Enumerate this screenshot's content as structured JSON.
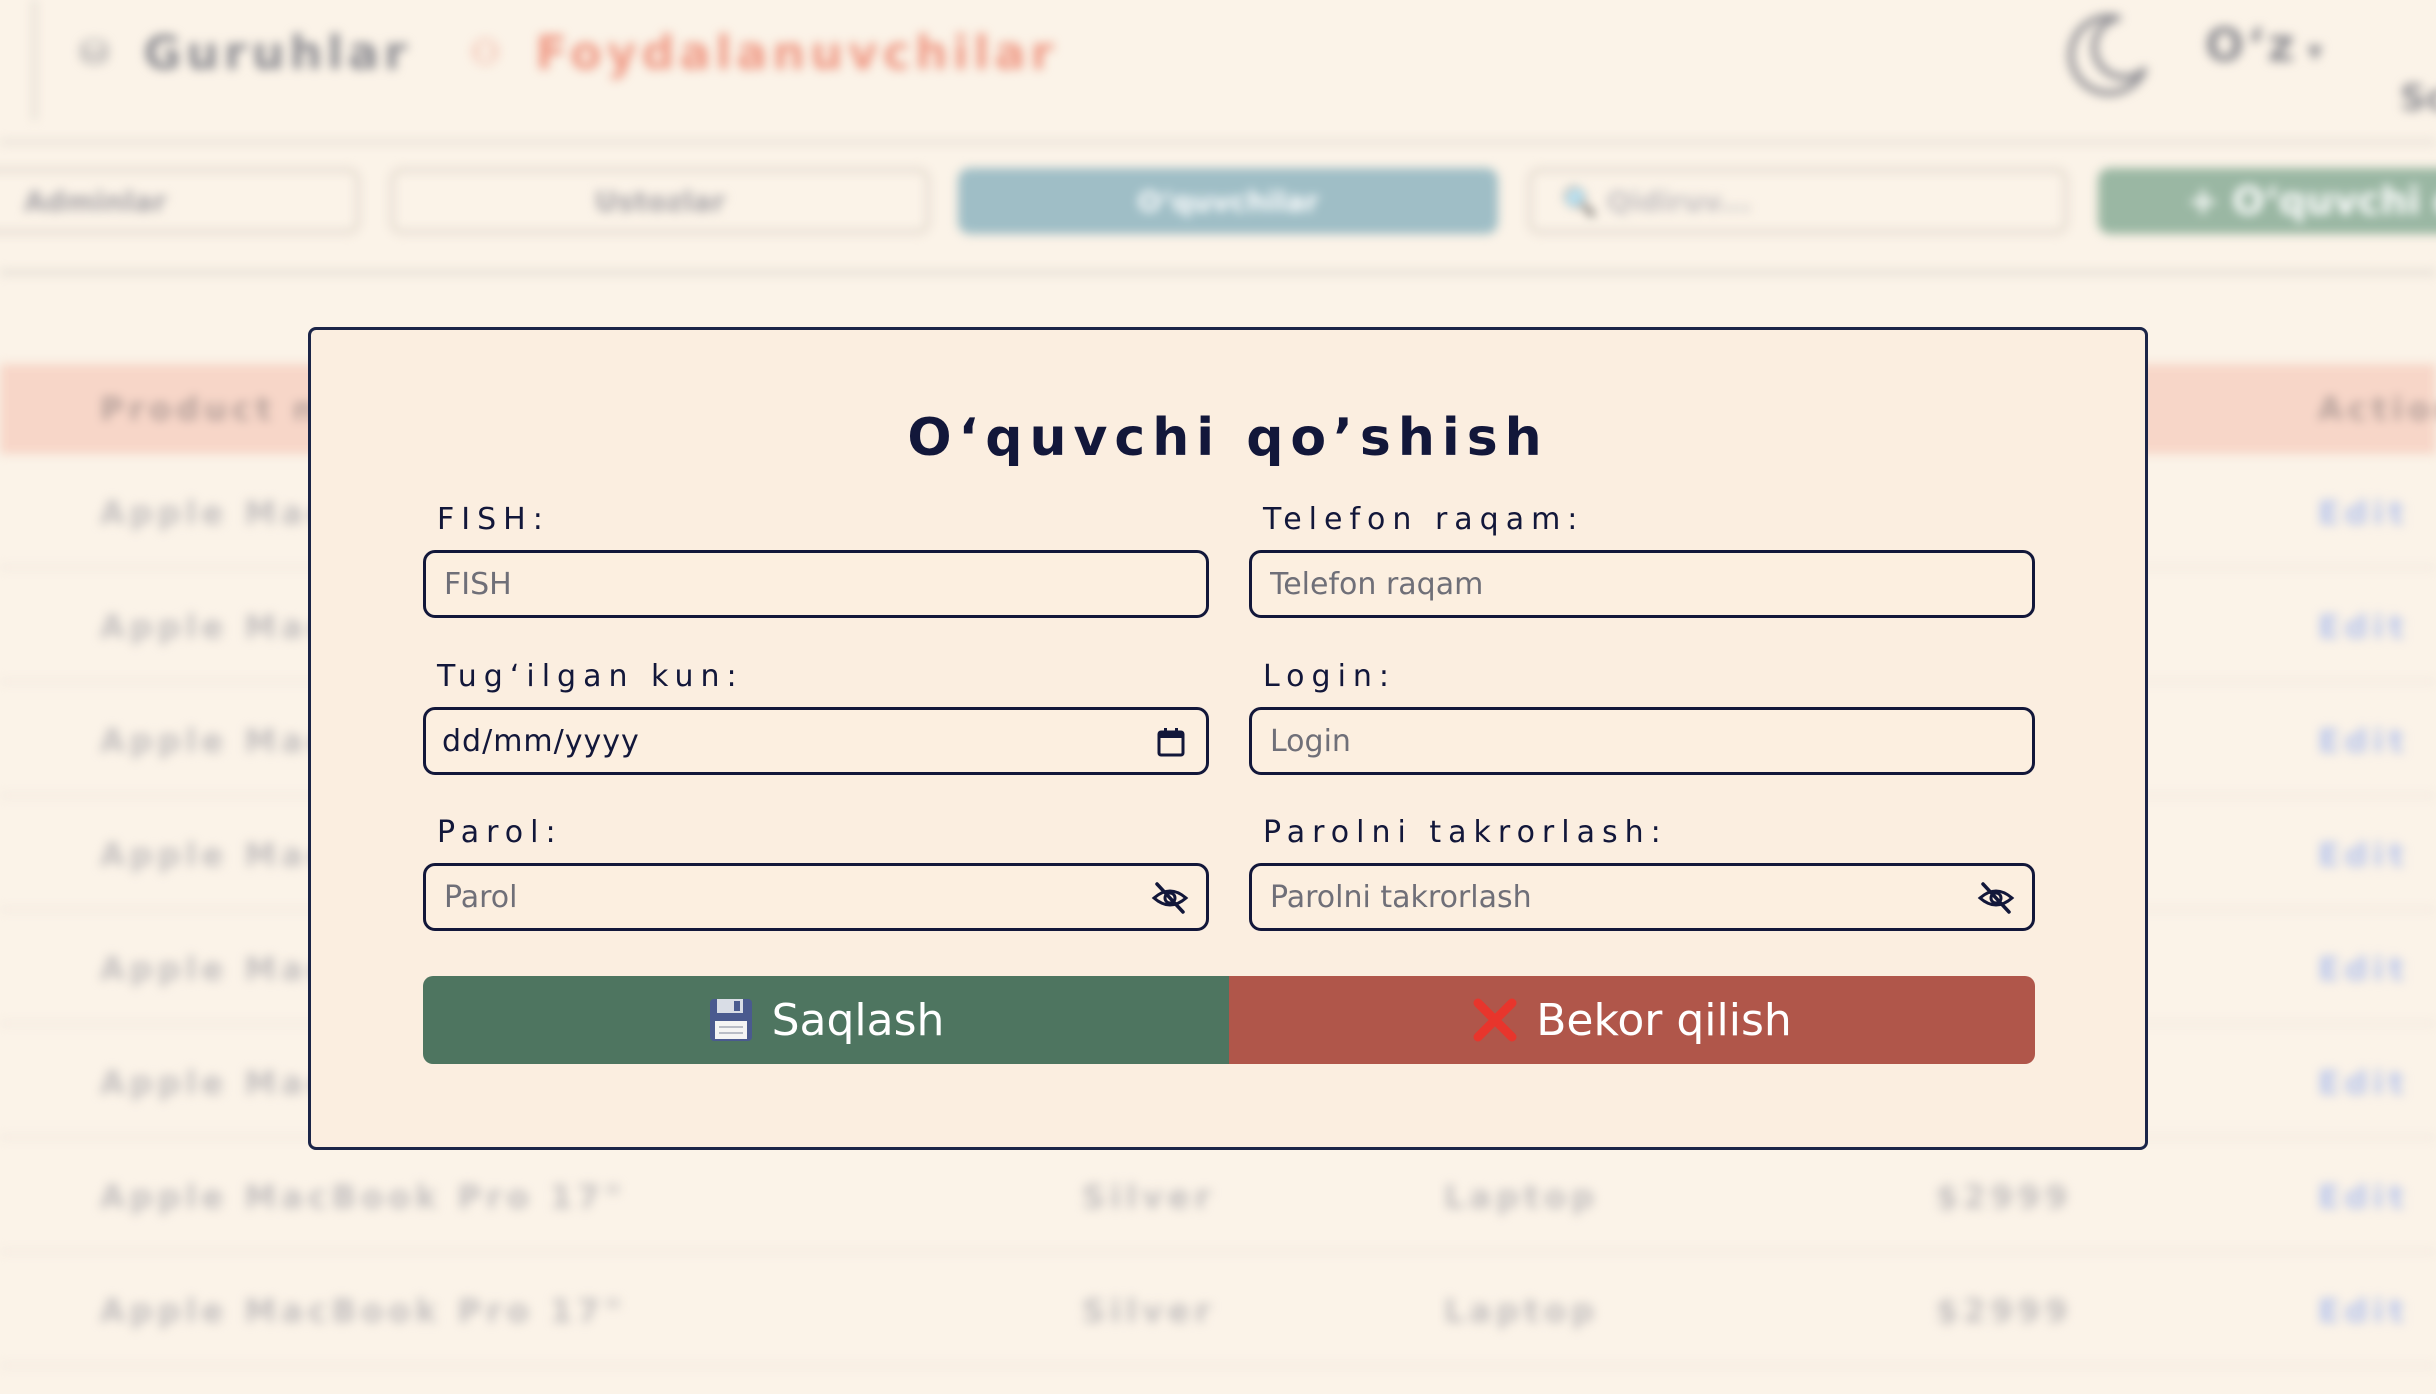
{
  "topbar": {
    "nav": [
      {
        "icon": "database-icon",
        "icon_glyph": "⛁",
        "label": "Guruhlar"
      },
      {
        "icon": "user-icon",
        "icon_glyph": "⚇",
        "label": "Foydalanuvchilar"
      }
    ],
    "theme_icon": "moon-icon",
    "language": {
      "selected": "O‘z",
      "arrow": "▾"
    },
    "corner_text": "Sc"
  },
  "toolbar": {
    "tabs": [
      "Adminlar",
      "Ustozlar",
      "O‘quvchilar"
    ],
    "search_placeholder": "🔍 Qidiruv...",
    "add_button_label": "+ O‘quvchi qo"
  },
  "table": {
    "headers": {
      "product": "Product na",
      "action": "Action"
    },
    "rows": [
      {
        "product": "Apple Mac",
        "color": "",
        "category": "",
        "price": "",
        "action": "Edit"
      },
      {
        "product": "Apple Mac",
        "color": "",
        "category": "",
        "price": "",
        "action": "Edit"
      },
      {
        "product": "Apple Mac",
        "color": "",
        "category": "",
        "price": "",
        "action": "Edit"
      },
      {
        "product": "Apple Mac",
        "color": "",
        "category": "",
        "price": "",
        "action": "Edit"
      },
      {
        "product": "Apple Mac",
        "color": "",
        "category": "",
        "price": "",
        "action": "Edit"
      },
      {
        "product": "Apple Mac",
        "color": "",
        "category": "",
        "price": "",
        "action": "Edit"
      },
      {
        "product": "Apple MacBook Pro 17\"",
        "color": "Silver",
        "category": "Laptop",
        "price": "$2999",
        "action": "Edit"
      },
      {
        "product": "Apple MacBook Pro 17\"",
        "color": "Silver",
        "category": "Laptop",
        "price": "$2999",
        "action": "Edit"
      }
    ]
  },
  "modal": {
    "title": "O‘quvchi qo’shish",
    "fields": {
      "fish": {
        "label": "FISH:",
        "placeholder": "FISH",
        "value": ""
      },
      "phone": {
        "label": "Telefon raqam:",
        "placeholder": "Telefon raqam",
        "value": ""
      },
      "birthdate": {
        "label": "Tug‘ilgan kun:",
        "value": "dd/mm/yyyy"
      },
      "login": {
        "label": "Login:",
        "placeholder": "Login",
        "value": ""
      },
      "password": {
        "label": "Parol:",
        "placeholder": "Parol",
        "value": ""
      },
      "password_repeat": {
        "label": "Parolni takrorlash:",
        "placeholder": "Parolni takrorlash",
        "value": ""
      }
    },
    "buttons": {
      "save": {
        "icon": "floppy-disk-icon",
        "label": "Saqlash"
      },
      "cancel": {
        "icon": "cross-mark-icon",
        "label": "Bekor qilish"
      }
    }
  },
  "colors": {
    "background": "#fbf3e8",
    "modal_background": "#fbeee0",
    "primary_text": "#12173a",
    "save_green": "#4e7560",
    "cancel_red": "#b0564a",
    "nav_active": "#ef9a86",
    "tab_active": "#9fbec6",
    "table_header": "#f7d6c8"
  }
}
